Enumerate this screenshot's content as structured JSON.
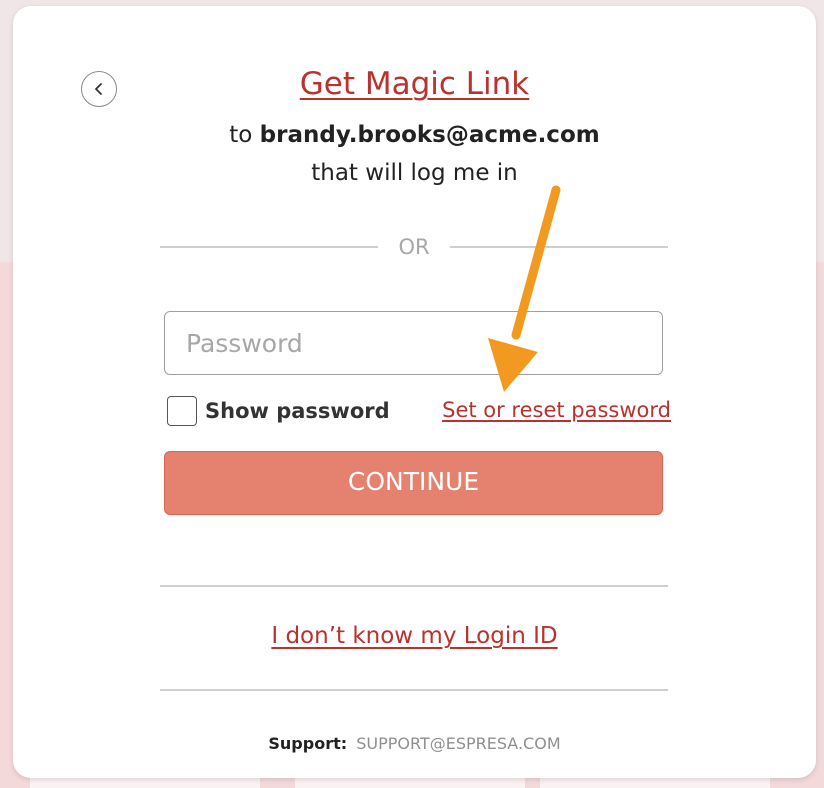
{
  "header": {
    "title_link": "Get Magic Link",
    "to_prefix": "to ",
    "email": "brandy.brooks@acme.com",
    "subtitle": "that will log me in"
  },
  "separator": {
    "or_text": "OR"
  },
  "form": {
    "password_placeholder": "Password",
    "password_value": "",
    "show_password_label": "Show password",
    "show_password_checked": false,
    "reset_link": "Set or reset password",
    "continue_label": "CONTINUE"
  },
  "footer": {
    "login_id_link": "I don’t know my Login ID",
    "support_label": "Support:",
    "support_email": "SUPPORT@ESPRESA.COM"
  },
  "icons": {
    "back": "chevron-left-icon",
    "annotation": "arrow-annotation-icon"
  },
  "colors": {
    "accent": "#b8332e",
    "button": "#e4826f",
    "annotation_arrow": "#f29a1f",
    "divider": "#cfcfcf"
  }
}
